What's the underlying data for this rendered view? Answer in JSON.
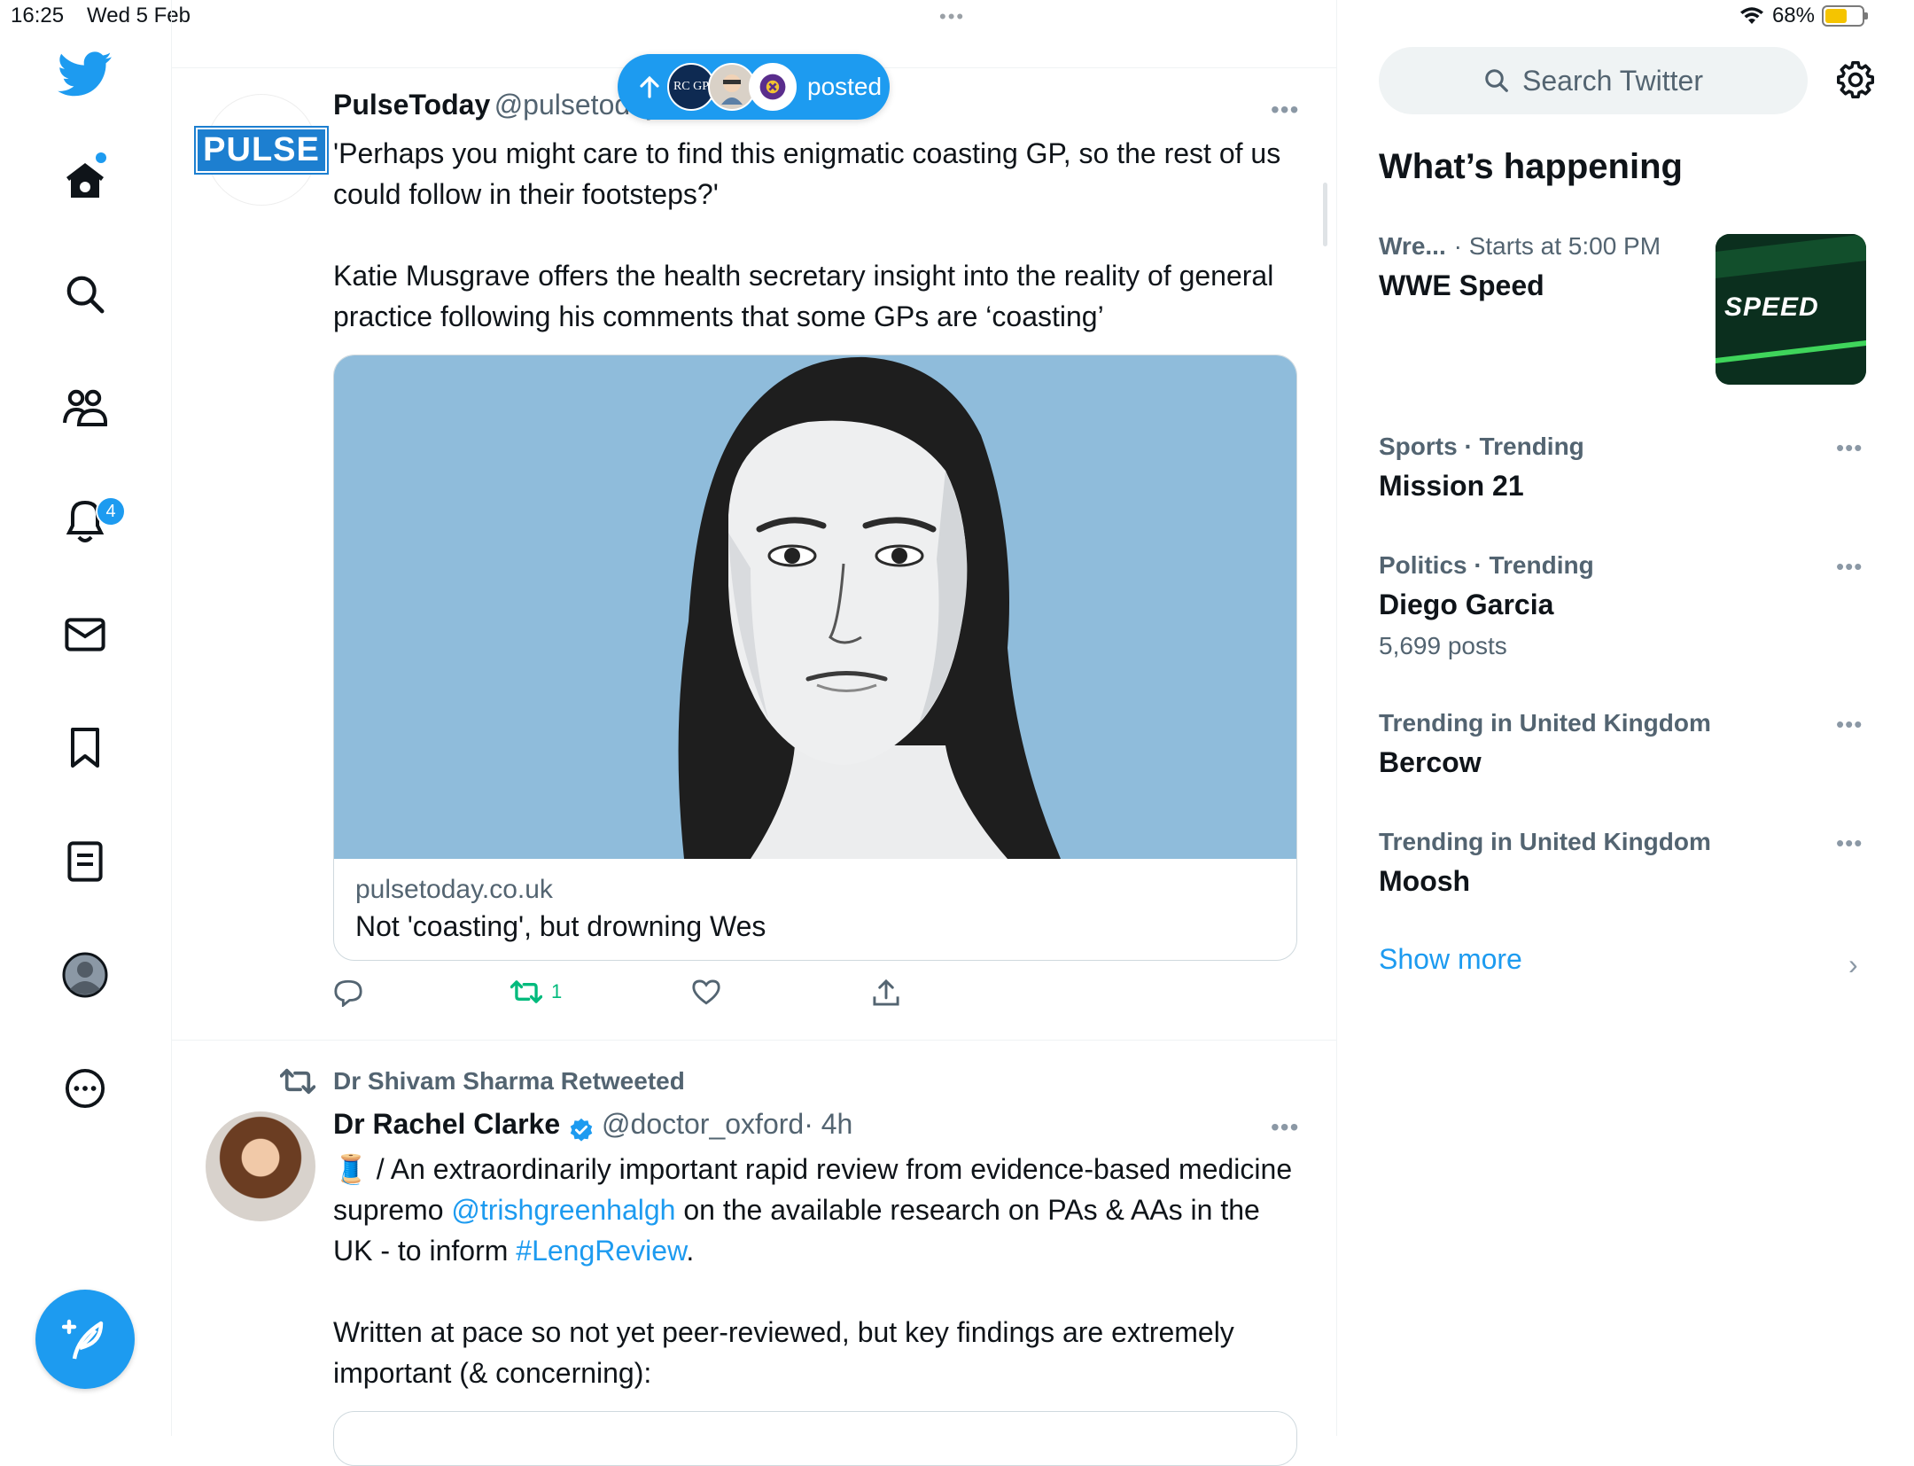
{
  "status_bar": {
    "time": "16:25",
    "date": "Wed 5 Feb",
    "battery": "68%",
    "battery_level": 0.68
  },
  "nav": {
    "items": [
      "home-icon",
      "explore-icon",
      "communities-icon",
      "notifications-icon",
      "messages-icon",
      "bookmarks-icon",
      "lists-icon",
      "profile-icon",
      "more-icon"
    ],
    "notifications_badge": "4"
  },
  "new_posts_pill": {
    "label": "posted",
    "avatar1_text": "RC GP"
  },
  "tweet1": {
    "avatar_logo": "PULSE",
    "name": "PulseToday",
    "handle": "@pulsetoday",
    "text1": "'Perhaps you might care to find this enigmatic coasting GP, so the rest of us could follow in their footsteps?'",
    "text2": "Katie Musgrave offers the health secretary insight into the reality of general practice following his comments that some GPs are ‘coasting’",
    "card_domain": "pulsetoday.co.uk",
    "card_title": "Not 'coasting', but drowning Wes",
    "retweet_count": "1"
  },
  "tweet2": {
    "retweeted_by": "Dr Shivam Sharma Retweeted",
    "name": "Dr Rachel Clarke",
    "handle": "@doctor_oxford",
    "time": "· 4h",
    "line1_pre": "🧵 / An extraordinarily important rapid review from evidence-based medicine supremo ",
    "mention": "@trishgreenhalgh",
    "line1_mid": " on the available research on PAs & AAs in the UK - to inform ",
    "hashtag": "#LengReview",
    "line1_end": ".",
    "text2": "Written at pace so not yet peer-reviewed, but key findings are extremely important (& concerning):"
  },
  "sidebar": {
    "search_placeholder": "Search Twitter",
    "whats_happening": "What’s happening",
    "trends": [
      {
        "meta_a": "Wre...",
        "meta_b": "· Starts at 5:00 PM",
        "name": "WWE Speed",
        "thumb_text": "SPEED"
      },
      {
        "meta": "Sports · Trending",
        "name": "Mission 21"
      },
      {
        "meta": "Politics · Trending",
        "name": "Diego Garcia",
        "count": "5,699 posts"
      },
      {
        "meta": "Trending in United Kingdom",
        "name": "Bercow"
      },
      {
        "meta": "Trending in United Kingdom",
        "name": "Moosh"
      }
    ],
    "show_more": "Show more"
  },
  "colors": {
    "accent": "#1d9bf0",
    "retweet_green": "#00ba7c",
    "muted": "#536471"
  }
}
